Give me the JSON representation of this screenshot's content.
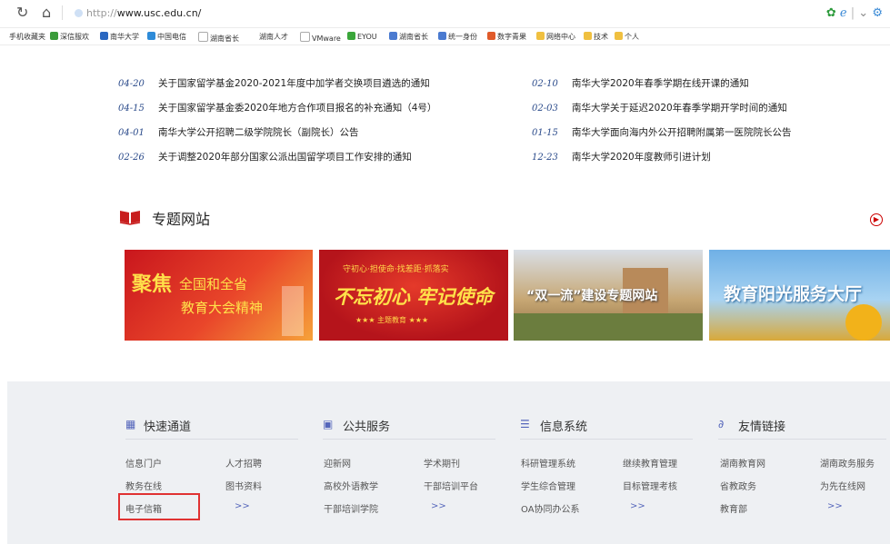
{
  "browser": {
    "url_prefix": "http://",
    "url_host": "www.usc.edu.cn/",
    "favorites": [
      "手机收藏夹",
      "深信服欢",
      "南华大学",
      "中国电信",
      "湖南省长",
      "湖南人才",
      "VMware",
      "EYOU",
      "湖南省长",
      "统一身份",
      "数字青果",
      "网络中心",
      "技术",
      "个人"
    ]
  },
  "news": {
    "left": [
      {
        "date": "04-20",
        "title": "关于国家留学基金2020-2021年度中加学者交换项目遴选的通知"
      },
      {
        "date": "04-15",
        "title": "关于国家留学基金委2020年地方合作项目报名的补充通知（4号）"
      },
      {
        "date": "04-01",
        "title": "南华大学公开招聘二级学院院长（副院长）公告"
      },
      {
        "date": "02-26",
        "title": "关于调整2020年部分国家公派出国留学项目工作安排的通知"
      }
    ],
    "right": [
      {
        "date": "02-10",
        "title": "南华大学2020年春季学期在线开课的通知"
      },
      {
        "date": "02-03",
        "title": "南华大学关于延迟2020年春季学期开学时间的通知"
      },
      {
        "date": "01-15",
        "title": "南华大学面向海内外公开招聘附属第一医院院长公告"
      },
      {
        "date": "12-23",
        "title": "南华大学2020年度教师引进计划"
      }
    ]
  },
  "topics": {
    "heading": "专题网站",
    "banners": [
      {
        "line1": "聚焦",
        "line2": "全国和全省",
        "line3": "教育大会精神"
      },
      {
        "line1": "守初心·担使命·找差距·抓落实",
        "line2": "不忘初心 牢记使命",
        "line3": "★★★ 主题教育 ★★★"
      },
      {
        "line1": "“双一流”建设专题网站"
      },
      {
        "line1": "教育阳光服务大厅"
      }
    ]
  },
  "footer": {
    "sections": [
      {
        "title": "快速通道",
        "icon": "grid-icon",
        "links": [
          "信息门户",
          "人才招聘",
          "教务在线",
          "图书资料",
          "电子信箱",
          ">>"
        ]
      },
      {
        "title": "公共服务",
        "icon": "monitor-icon",
        "links": [
          "迎新网",
          "学术期刊",
          "高校外语教学",
          "干部培训平台",
          "干部培训学院",
          ">>"
        ]
      },
      {
        "title": "信息系统",
        "icon": "list-icon",
        "links": [
          "科研管理系统",
          "继续教育管理",
          "学生综合管理",
          "目标管理考核",
          "OA协同办公系",
          ">>"
        ]
      },
      {
        "title": "友情链接",
        "icon": "link-icon",
        "links": [
          "湖南教育网",
          "湖南政务服务",
          "省教政务",
          "为先在线网",
          "教育部",
          ">>"
        ]
      }
    ]
  },
  "colors": {
    "accent": "#c81e1e",
    "date": "#2a4a8a",
    "highlight": "#e03232"
  }
}
